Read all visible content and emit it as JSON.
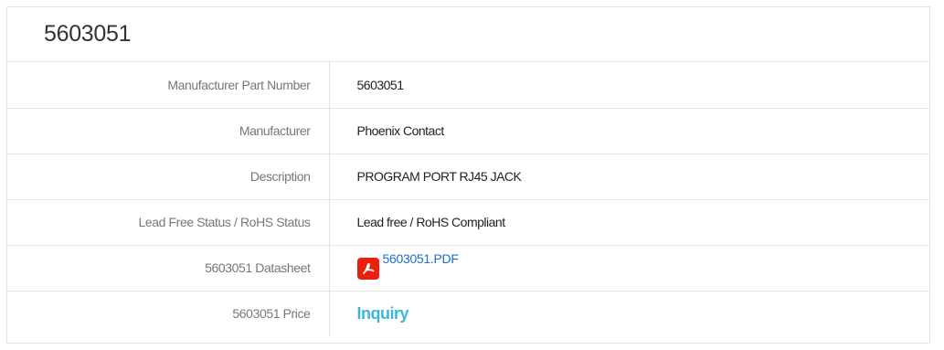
{
  "title": "5603051",
  "rows": [
    {
      "label": "Manufacturer Part Number",
      "value": "5603051"
    },
    {
      "label": "Manufacturer",
      "value": "Phoenix Contact"
    },
    {
      "label": "Description",
      "value": "PROGRAM PORT RJ45 JACK"
    },
    {
      "label": "Lead Free Status / RoHS Status",
      "value": "Lead free / RoHS Compliant"
    },
    {
      "label": "5603051 Datasheet",
      "value": "5603051.PDF",
      "icon": "pdf-icon"
    },
    {
      "label": "5603051 Price",
      "value": "Inquiry"
    }
  ],
  "colors": {
    "pdf_icon": "#e8200d",
    "link": "#1d6fc9",
    "inquiry": "#3bb6d6"
  }
}
